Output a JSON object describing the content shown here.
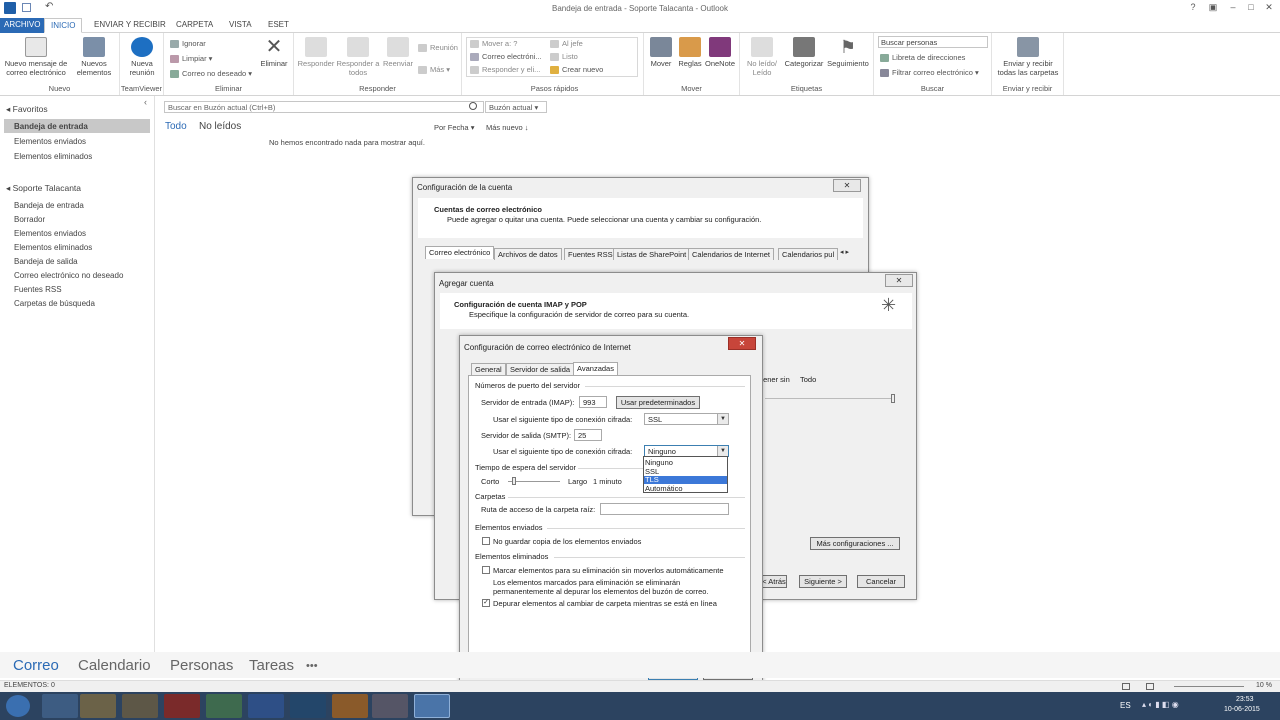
{
  "window": {
    "title": "Bandeja de entrada - Soporte Talacanta - Outlook"
  },
  "tabs": [
    "ARCHIVO",
    "INICIO",
    "ENVIAR Y RECIBIR",
    "CARPETA",
    "VISTA",
    "ESET"
  ],
  "ribbon": {
    "nuevo": {
      "new_mail": "Nuevo mensaje de correo electrónico",
      "new_items": "Nuevos elementos",
      "label": "Nuevo"
    },
    "teamviewer": {
      "meeting": "Nueva reunión",
      "label": "TeamViewer"
    },
    "eliminar": {
      "ignore": "Ignorar",
      "clean": "Limpiar",
      "junk": "Correo no deseado",
      "delete": "Eliminar",
      "label": "Eliminar"
    },
    "responder": {
      "reply": "Responder",
      "reply_all": "Responder a todos",
      "forward": "Reenviar",
      "meeting": "Reunión",
      "more": "Más",
      "label": "Responder"
    },
    "pasos": {
      "move_to": "Mover a: ?",
      "email": "Correo electróni...",
      "reply_del": "Responder y eli...",
      "to_boss": "Al jefe",
      "done": "Listo",
      "create": "Crear nuevo",
      "label": "Pasos rápidos"
    },
    "mover": {
      "move": "Mover",
      "rules": "Reglas",
      "onenote": "OneNote",
      "label": "Mover"
    },
    "etiquetas": {
      "unread": "No leído/ Leído",
      "categorize": "Categorizar",
      "follow": "Seguimiento",
      "label": "Etiquetas"
    },
    "buscar": {
      "people": "Buscar personas",
      "address": "Libreta de direcciones",
      "filter": "Filtrar correo electrónico",
      "label": "Buscar"
    },
    "enviar": {
      "sendall": "Enviar y recibir todas las carpetas",
      "label": "Enviar y recibir"
    }
  },
  "favorites": {
    "header": "Favoritos",
    "items": [
      "Bandeja de entrada",
      "Elementos enviados",
      "Elementos eliminados"
    ]
  },
  "account": {
    "header": "Soporte Talacanta",
    "items": [
      "Bandeja de entrada",
      "Borrador",
      "Elementos enviados",
      "Elementos eliminados",
      "Bandeja de salida",
      "Correo electrónico no deseado",
      "Fuentes RSS",
      "Carpetas de búsqueda"
    ]
  },
  "maillist": {
    "search_placeholder": "Buscar en Buzón actual (Ctrl+B)",
    "scope": "Buzón actual",
    "filter_all": "Todo",
    "filter_unread": "No leídos",
    "sort_by": "Por Fecha",
    "sort_order": "Más nuevo",
    "empty": "No hemos encontrado nada para mostrar aquí."
  },
  "navbar": [
    "Correo",
    "Calendario",
    "Personas",
    "Tareas",
    "•••"
  ],
  "status": {
    "items": "ELEMENTOS: 0",
    "zoom": "10 %"
  },
  "tray": {
    "lang": "ES",
    "time": "23:53",
    "date": "10-06-2015"
  },
  "account_settings": {
    "title": "Configuración de la cuenta",
    "heading": "Cuentas de correo electrónico",
    "desc": "Puede agregar o quitar una cuenta. Puede seleccionar una cuenta y cambiar su configuración.",
    "tabs": [
      "Correo electrónico",
      "Archivos de datos",
      "Fuentes RSS",
      "Listas de SharePoint",
      "Calendarios de Internet",
      "Calendarios pul"
    ]
  },
  "add_account": {
    "title": "Agregar cuenta",
    "heading": "Configuración de cuenta IMAP y POP",
    "desc": "Especifique la configuración de servidor de correo para su cuenta.",
    "keep": "tener sin",
    "all": "Todo",
    "more_settings": "Más configuraciones ...",
    "back": "< Atrás",
    "next": "Siguiente >",
    "cancel": "Cancelar"
  },
  "internet_settings": {
    "title": "Configuración de correo electrónico de Internet",
    "tabs": [
      "General",
      "Servidor de salida",
      "Avanzadas"
    ],
    "ports_section": "Números de puerto del servidor",
    "incoming_label": "Servidor de entrada (IMAP):",
    "incoming_port": "993",
    "use_defaults": "Usar predeterminados",
    "enc_label": "Usar el siguiente tipo de conexión cifrada:",
    "enc_in": "SSL",
    "outgoing_label": "Servidor de salida (SMTP):",
    "outgoing_port": "25",
    "enc_out": "Ninguno",
    "enc_options": [
      "Ninguno",
      "SSL",
      "TLS",
      "Automático"
    ],
    "timeout_section": "Tiempo de espera del servidor",
    "short": "Corto",
    "long": "Largo",
    "timeout_val": "1 minuto",
    "folders_section": "Carpetas",
    "root_label": "Ruta de acceso de la carpeta raíz:",
    "sent_section": "Elementos enviados",
    "no_copy": "No guardar copia de los elementos enviados",
    "deleted_section": "Elementos eliminados",
    "mark_del": "Marcar elementos para su eliminación sin moverlos automáticamente",
    "mark_note1": "Los elementos marcados para eliminación se eliminarán",
    "mark_note2": "permanentemente al depurar los elementos del buzón de correo.",
    "purge": "Depurar elementos al cambiar de carpeta mientras se está en línea",
    "ok": "Aceptar",
    "cancel": "Cancelar"
  }
}
